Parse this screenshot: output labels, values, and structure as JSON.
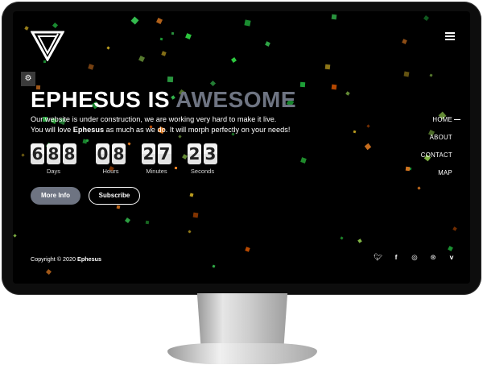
{
  "site": {
    "title_main": "EPHESUS IS ",
    "title_accent": "AWESOME",
    "desc_line1": "Our website is under construction, we are working very hard to make it live.",
    "desc_line2_pre": "You will love ",
    "desc_line2_brand": "Ephesus",
    "desc_line2_post": " as much as we do. It will morph perfectly on your needs!"
  },
  "countdown": {
    "days": [
      "6",
      "8",
      "8"
    ],
    "hours": [
      "0",
      "8"
    ],
    "minutes": [
      "2",
      "7"
    ],
    "seconds": [
      "2",
      "3"
    ],
    "labels": {
      "days": "Days",
      "hours": "Hours",
      "minutes": "Minutes",
      "seconds": "Seconds"
    }
  },
  "buttons": {
    "more_info": "More Info",
    "subscribe": "Subscribe"
  },
  "nav": {
    "items": [
      "HOME",
      "ABOUT",
      "CONTACT",
      "MAP"
    ]
  },
  "footer": {
    "copyright_pre": "Copyright © 2020 ",
    "copyright_brand": "Ephesus"
  },
  "icons": {
    "menu": "hamburger-icon",
    "settings": "cogs-icon",
    "social": [
      "twitter-icon",
      "facebook-icon",
      "instagram-icon",
      "dribbble-icon",
      "vimeo-icon"
    ]
  },
  "colors": {
    "accent": "#6e7482",
    "background": "#000000",
    "text": "#ffffff"
  }
}
